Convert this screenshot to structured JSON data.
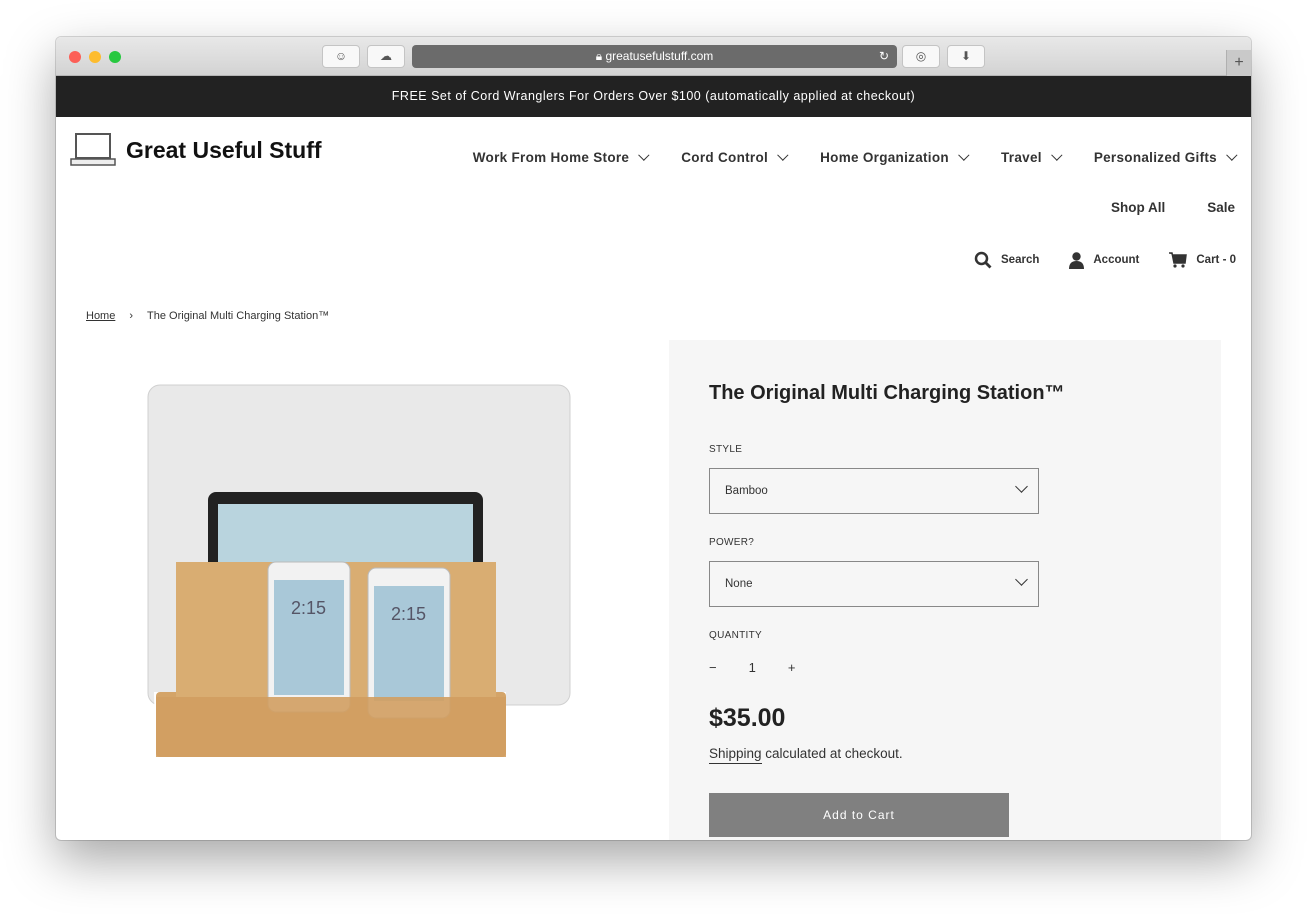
{
  "browser": {
    "url": "greatusefulstuff.com"
  },
  "announcement": "FREE Set of Cord Wranglers For Orders Over $100 (automatically applied at checkout)",
  "logo": "Great Useful Stuff",
  "nav": [
    "Work From Home Store",
    "Cord Control",
    "Home Organization",
    "Travel",
    "Personalized Gifts"
  ],
  "nav2": [
    "Shop All",
    "Sale"
  ],
  "utility": {
    "search": "Search",
    "account": "Account",
    "cart": "Cart - 0"
  },
  "breadcrumb": {
    "home": "Home",
    "sep": "›",
    "current": "The Original Multi Charging Station™"
  },
  "product": {
    "title": "The Original Multi Charging Station™",
    "style_label": "STYLE",
    "style_value": "Bamboo",
    "power_label": "POWER?",
    "power_value": "None",
    "quantity_label": "QUANTITY",
    "qty_minus": "−",
    "qty": "1",
    "qty_plus": "+",
    "price": "$35.00",
    "shipping_link": "Shipping",
    "shipping_rest": " calculated at checkout.",
    "add_to_cart": "Add to Cart",
    "phone_time": "2:15"
  }
}
